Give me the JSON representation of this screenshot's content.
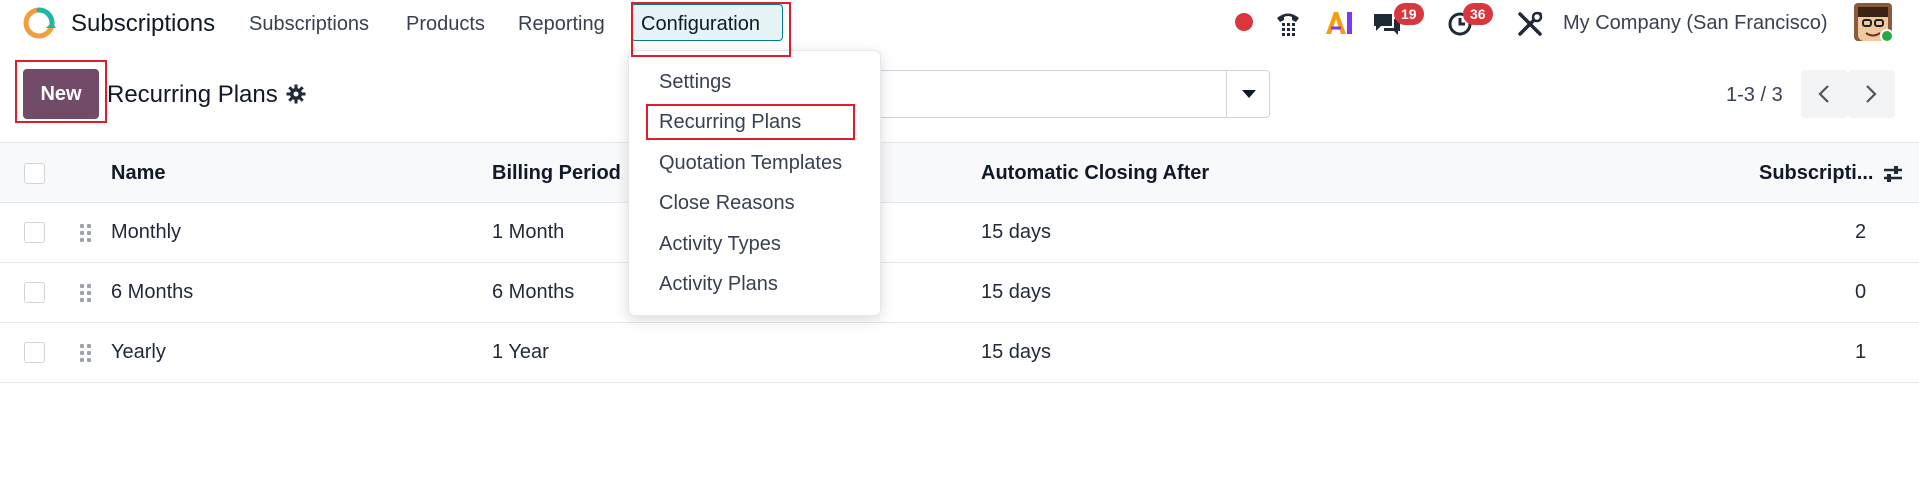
{
  "navbar": {
    "app_name": "Subscriptions",
    "menu": {
      "subscriptions": "Subscriptions",
      "products": "Products",
      "reporting": "Reporting",
      "configuration": "Configuration"
    },
    "messages_badge": "19",
    "activities_badge": "36",
    "company": "My Company (San Francisco)"
  },
  "control_panel": {
    "new_label": "New",
    "title": "Recurring Plans",
    "pager": "1-3 / 3"
  },
  "table": {
    "headers": {
      "name": "Name",
      "billing_period": "Billing Period",
      "auto_close": "Automatic Closing After",
      "subscriptions": "Subscripti..."
    },
    "rows": [
      {
        "name": "Monthly",
        "billing_period": "1 Month",
        "auto_close": "15 days",
        "subscriptions": "2"
      },
      {
        "name": "6 Months",
        "billing_period": "6 Months",
        "auto_close": "15 days",
        "subscriptions": "0"
      },
      {
        "name": "Yearly",
        "billing_period": "1 Year",
        "auto_close": "15 days",
        "subscriptions": "1"
      }
    ]
  },
  "config_menu": {
    "items": [
      "Settings",
      "Recurring Plans",
      "Quotation Templates",
      "Close Reasons",
      "Activity Types",
      "Activity Plans"
    ]
  },
  "colors": {
    "brand": "#714b67",
    "accent": "#017e84",
    "badge": "#d9363e",
    "highlight": "#e11d2a"
  },
  "icons": [
    "app-logo",
    "record-icon",
    "phone-icon",
    "ai-icon",
    "chat-icon",
    "clock-icon",
    "tools-icon",
    "gear-icon",
    "caret-down-icon",
    "chevron-left-icon",
    "chevron-right-icon",
    "drag-handle-icon",
    "column-settings-icon"
  ]
}
